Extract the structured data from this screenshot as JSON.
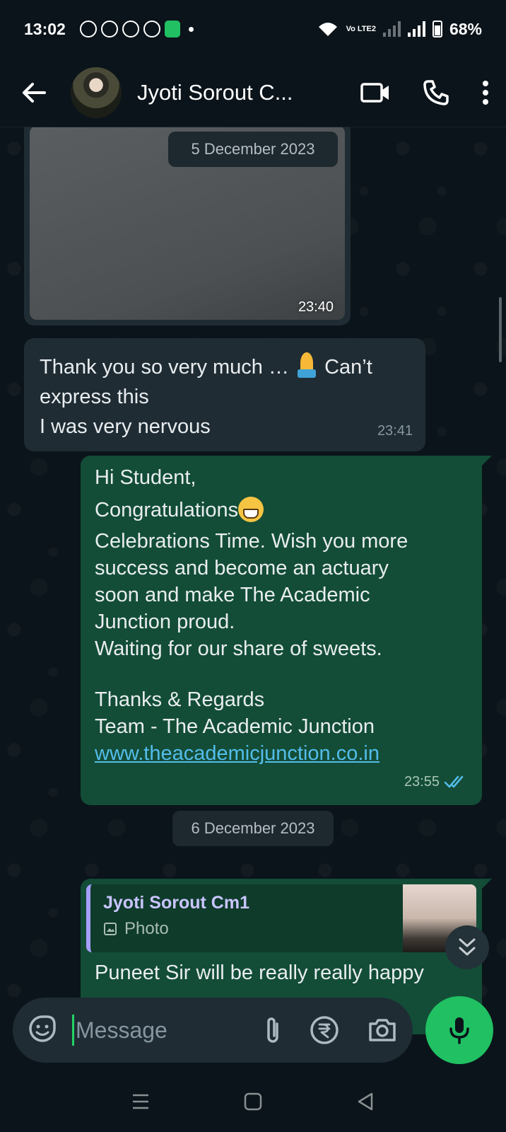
{
  "status_bar": {
    "time": "13:02",
    "network_label": "Vo LTE2",
    "battery": "68%",
    "notification_icons": [
      "whatsapp-icon",
      "whatsapp-icon",
      "whatsapp-icon",
      "chrome-icon",
      "app-icon"
    ]
  },
  "header": {
    "contact_name": "Jyoti Sorout C...",
    "actions": [
      "video-call-icon",
      "voice-call-icon",
      "more-options-icon"
    ]
  },
  "messages": {
    "photo_time": "23:40",
    "date_1": "5 December 2023",
    "incoming": {
      "line1_a": "Thank you so very much … ",
      "line1_b": " Can’t",
      "line2": "express this",
      "line3": "I was very nervous",
      "time": "23:41"
    },
    "outgoing": {
      "greeting": "Hi Student,",
      "congrats": "Congratulations",
      "body1": "Celebrations Time. Wish you more",
      "body2": "success and become an actuary",
      "body3": "soon and make The Academic",
      "body4": "Junction proud.",
      "body5": "Waiting for our share of sweets.",
      "sign1": "Thanks & Regards",
      "sign2": "Team - The Academic Junction",
      "link": "www.theacademicjunction.co.in",
      "time": "23:55",
      "status": "read"
    },
    "date_2": "6 December 2023",
    "reply": {
      "quoted_name": "Jyoti Sorout Cm1",
      "quoted_type": "Photo",
      "text": "Puneet Sir will be really really happy"
    }
  },
  "composer": {
    "placeholder": "Message"
  },
  "colors": {
    "background": "#0b141a",
    "incoming_bubble": "#1f2c34",
    "outgoing_bubble": "#134d37",
    "accent_green": "#21c063",
    "link": "#53bdeb",
    "read_ticks": "#53bdeb"
  }
}
